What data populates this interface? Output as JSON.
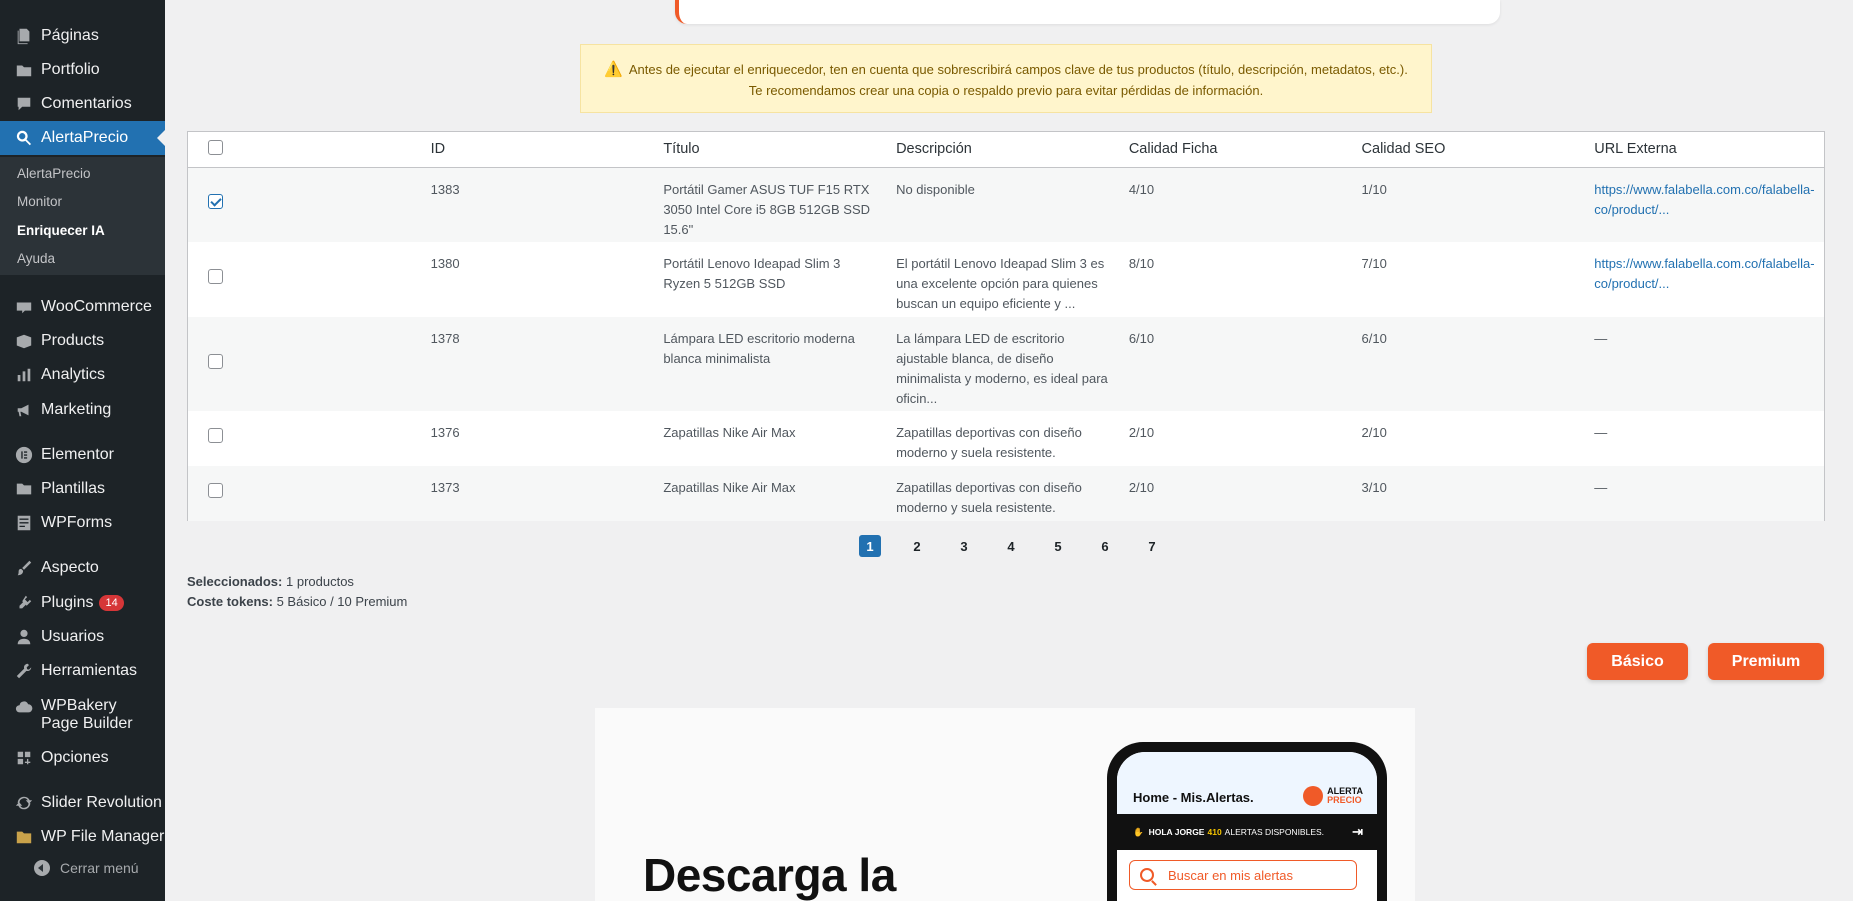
{
  "sidebar": {
    "items": [
      {
        "key": "paginas",
        "label": "Páginas",
        "icon": "pages-icon"
      },
      {
        "key": "portfolio",
        "label": "Portfolio",
        "icon": "portfolio-icon"
      },
      {
        "key": "comentarios",
        "label": "Comentarios",
        "icon": "comments-icon"
      },
      {
        "key": "alertaprecio",
        "label": "AlertaPrecio",
        "icon": "search-icon"
      },
      {
        "key": "woocommerce",
        "label": "WooCommerce",
        "icon": "woocommerce-icon"
      },
      {
        "key": "products",
        "label": "Products",
        "icon": "products-icon"
      },
      {
        "key": "analytics",
        "label": "Analytics",
        "icon": "analytics-icon"
      },
      {
        "key": "marketing",
        "label": "Marketing",
        "icon": "megaphone-icon"
      },
      {
        "key": "elementor",
        "label": "Elementor",
        "icon": "elementor-icon"
      },
      {
        "key": "plantillas",
        "label": "Plantillas",
        "icon": "folder-icon"
      },
      {
        "key": "wpforms",
        "label": "WPForms",
        "icon": "forms-icon"
      },
      {
        "key": "aspecto",
        "label": "Aspecto",
        "icon": "brush-icon"
      },
      {
        "key": "plugins",
        "label": "Plugins",
        "icon": "plugin-icon",
        "badge": "14"
      },
      {
        "key": "usuarios",
        "label": "Usuarios",
        "icon": "user-icon"
      },
      {
        "key": "herramientas",
        "label": "Herramientas",
        "icon": "wrench-icon"
      },
      {
        "key": "wpbakery",
        "label": "WPBakery Page Builder",
        "icon": "cloud-icon"
      },
      {
        "key": "opciones",
        "label": "Opciones",
        "icon": "settings-icon"
      },
      {
        "key": "slider",
        "label": "Slider Revolution",
        "icon": "refresh-icon"
      },
      {
        "key": "filemanager",
        "label": "WP File Manager",
        "icon": "file-manager-icon"
      }
    ],
    "submenu": [
      "AlertaPrecio",
      "Monitor",
      "Enriquecer IA",
      "Ayuda"
    ],
    "collapse_label": "Cerrar menú"
  },
  "warning": {
    "line1": "Antes de ejecutar el enriquecedor, ten en cuenta que sobrescribirá campos clave de tus productos (título, descripción, metadatos, etc.).",
    "line2": "Te recomendamos crear una copia o respaldo previo para evitar pérdidas de información."
  },
  "table": {
    "headers": [
      "ID",
      "Título",
      "Descripción",
      "Calidad Ficha",
      "Calidad SEO",
      "URL Externa"
    ],
    "rows": [
      {
        "checked": true,
        "id": "1383",
        "title": "Portátil Gamer ASUS TUF F15 RTX 3050 Intel Core i5 8GB 512GB SSD 15.6\"",
        "desc": "No disponible",
        "ficha": "4/10",
        "seo": "1/10",
        "url": "https://www.falabella.com.co/falabella-co/product/..."
      },
      {
        "checked": false,
        "id": "1380",
        "title": "Portátil Lenovo Ideapad Slim 3 Ryzen 5 512GB SSD",
        "desc": "El portátil Lenovo Ideapad Slim 3 es una excelente opción para quienes buscan un equipo eficiente y ...",
        "ficha": "8/10",
        "seo": "7/10",
        "url": "https://www.falabella.com.co/falabella-co/product/..."
      },
      {
        "checked": false,
        "id": "1378",
        "title": "Lámpara LED escritorio moderna blanca minimalista",
        "desc": "La lámpara LED de escritorio ajustable blanca, de diseño minimalista y moderno, es ideal para oficin...",
        "ficha": "6/10",
        "seo": "6/10",
        "url": "—"
      },
      {
        "checked": false,
        "id": "1376",
        "title": "Zapatillas Nike Air Max",
        "desc": "Zapatillas deportivas con diseño moderno y suela resistente.",
        "ficha": "2/10",
        "seo": "2/10",
        "url": "—"
      },
      {
        "checked": false,
        "id": "1373",
        "title": "Zapatillas Nike Air Max",
        "desc": "Zapatillas deportivas con diseño moderno y suela resistente.",
        "ficha": "2/10",
        "seo": "3/10",
        "url": "—"
      }
    ]
  },
  "pagination": {
    "pages": [
      "1",
      "2",
      "3",
      "4",
      "5",
      "6",
      "7"
    ],
    "current": "1"
  },
  "summary": {
    "selected_label": "Seleccionados:",
    "selected_value": "1 productos",
    "cost_label": "Coste tokens:",
    "cost_value": "5 Básico / 10 Premium"
  },
  "buttons": {
    "basic": "Básico",
    "premium": "Premium"
  },
  "promo": {
    "title": "Descarga la",
    "phone_title": "Home - Mis.Alertas.",
    "logo_top": "ALERTA",
    "logo_bottom": "PRECIO",
    "greeting": "HOLA JORGE",
    "alerts_count": "410",
    "alerts_label": "ALERTAS DISPONIBLES.",
    "search_placeholder": "Buscar en mis alertas"
  },
  "colors": {
    "accent": "#f05a28",
    "wp_blue": "#2271b1",
    "sidebar_bg": "#1d2327"
  }
}
